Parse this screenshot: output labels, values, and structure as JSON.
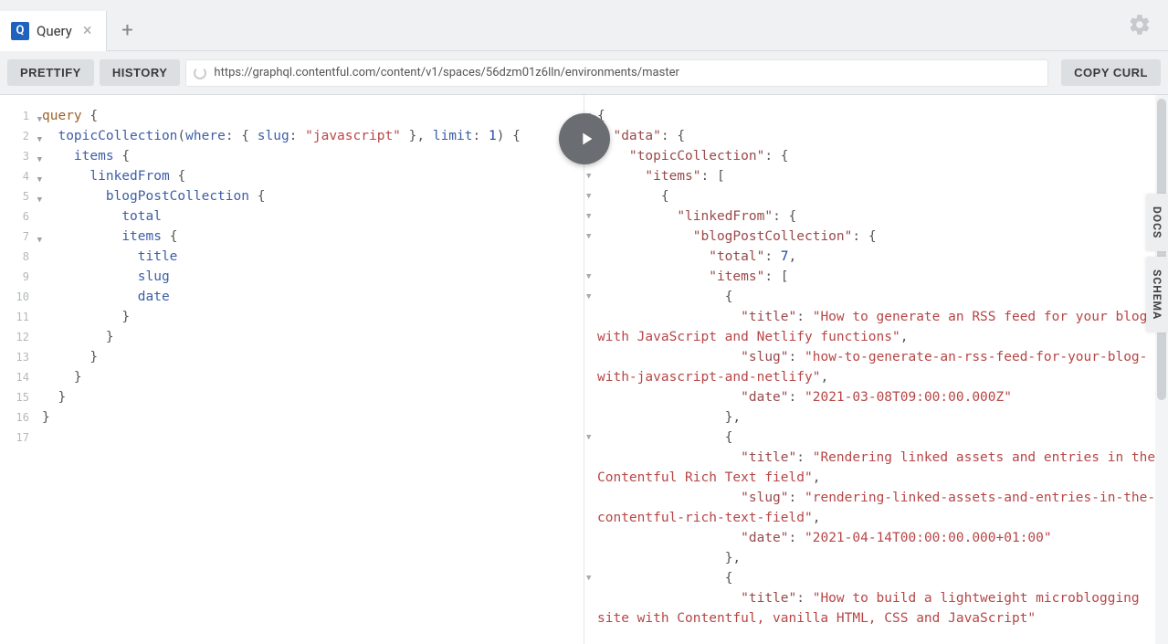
{
  "tab": {
    "title": "Query",
    "icon_label": "Q"
  },
  "toolbar": {
    "prettify": "PRETTIFY",
    "history": "HISTORY",
    "copy_curl": "COPY CURL",
    "url": "https://graphql.contentful.com/content/v1/spaces/56dzm01z6lln/environments/master"
  },
  "side": {
    "docs": "DOCS",
    "schema": "SCHEMA"
  },
  "query": {
    "line_count": 17,
    "fold_lines": [
      1,
      2,
      3,
      4,
      5,
      7
    ],
    "tokens": {
      "kw_query": "query",
      "field_topicCollection": "topicCollection",
      "arg_where": "where",
      "arg_slug": "slug",
      "val_slug": "javascript",
      "arg_limit": "limit",
      "val_limit": "1",
      "field_items": "items",
      "field_linkedFrom": "linkedFrom",
      "field_blogPostCollection": "blogPostCollection",
      "field_total": "total",
      "field_title": "title",
      "field_slug": "slug",
      "field_date": "date"
    }
  },
  "response": {
    "total": 7,
    "items": [
      {
        "title": "How to generate an RSS feed for your blog with JavaScript and Netlify functions",
        "slug": "how-to-generate-an-rss-feed-for-your-blog-with-javascript-and-netlify",
        "date": "2021-03-08T09:00:00.000Z"
      },
      {
        "title": "Rendering linked assets and entries in the Contentful Rich Text field",
        "slug": "rendering-linked-assets-and-entries-in-the-contentful-rich-text-field",
        "date": "2021-04-14T00:00:00.000+01:00"
      },
      {
        "title": "How to build a lightweight microblogging site with Contentful, vanilla HTML, CSS and JavaScript"
      }
    ]
  },
  "chart_data": null
}
